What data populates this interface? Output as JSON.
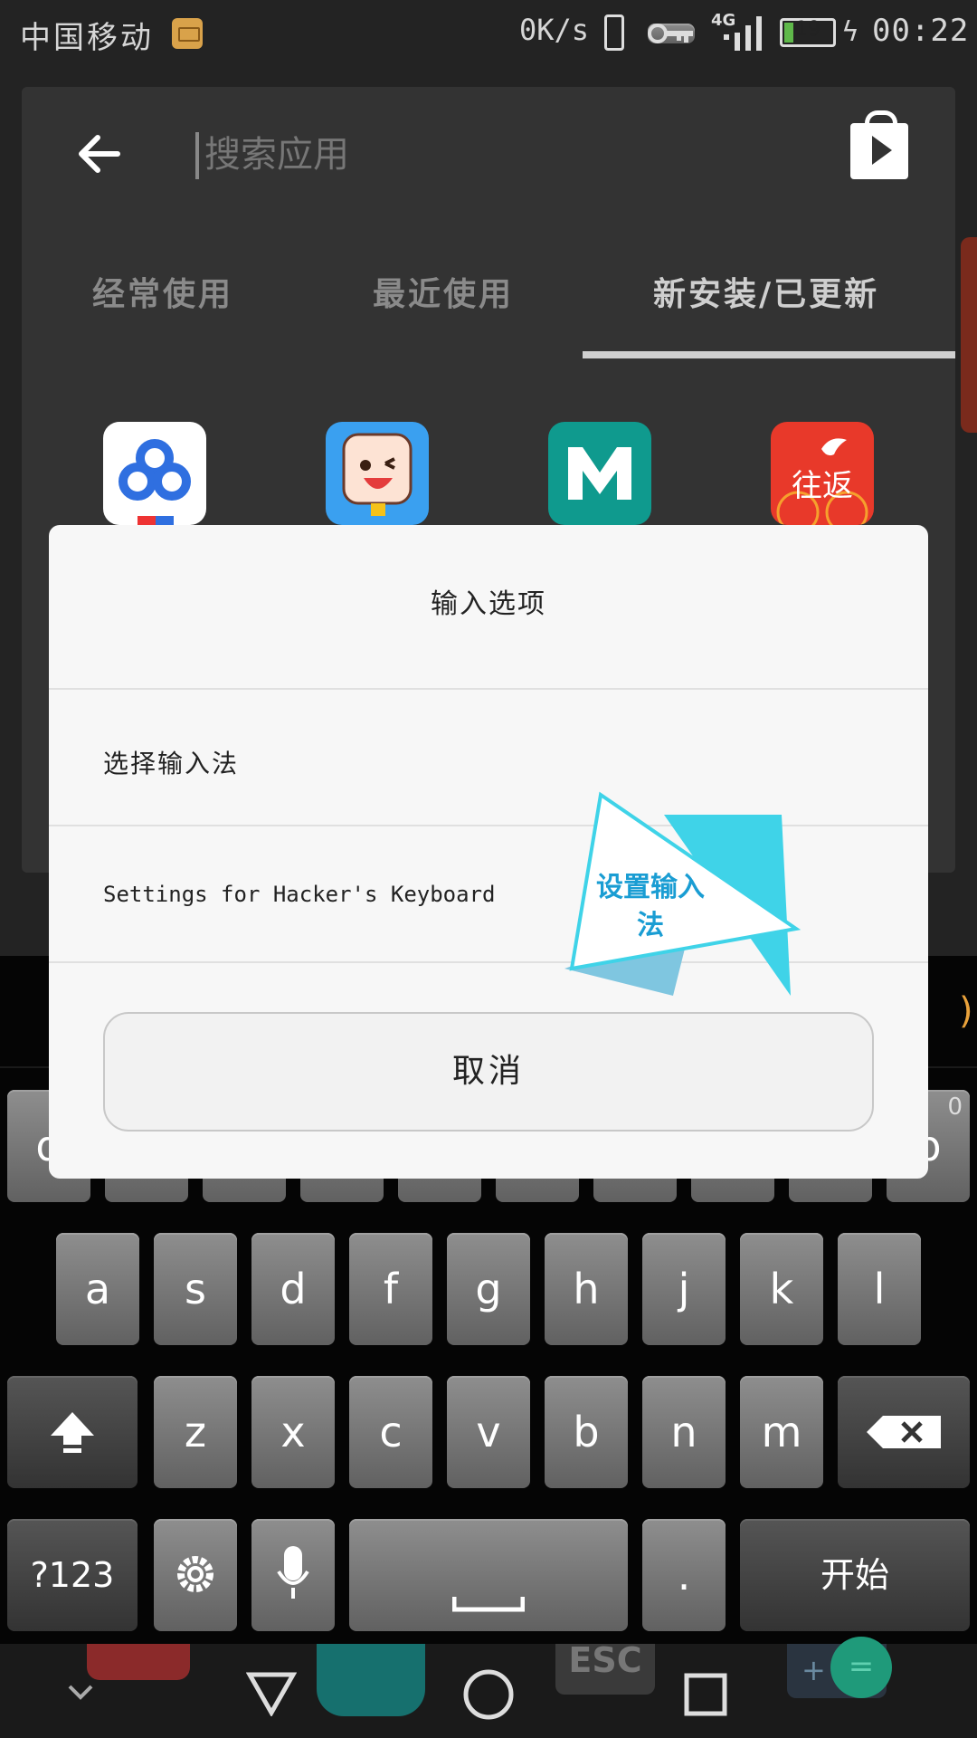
{
  "status_bar": {
    "carrier": "中国移动",
    "speed": "0K/s",
    "network": "4G",
    "battery": "19",
    "battery_level": 0.19,
    "time": "00:22"
  },
  "drawer": {
    "search_placeholder": "搜索应用",
    "tabs": [
      {
        "label": "经常使用"
      },
      {
        "label": "最近使用"
      },
      {
        "label": "新安装/已更新"
      }
    ],
    "active_tab": 2,
    "apps": [
      {
        "icon": "baidu-cloud-icon",
        "color": "#ffffff"
      },
      {
        "icon": "cartoon-face-icon",
        "color": "#3aa0f0"
      },
      {
        "icon": "m-letter-icon",
        "color": "#0f9a8e",
        "glyph": "M"
      },
      {
        "icon": "festival-icon",
        "color": "#e8392a",
        "glyph": "往返"
      }
    ]
  },
  "dialog": {
    "title": "输入选项",
    "options": [
      {
        "label": "选择输入法"
      },
      {
        "label": "Settings for Hacker's Keyboard"
      }
    ],
    "cancel": "取消",
    "badge_text": "设置输入法"
  },
  "keyboard": {
    "row_top_left": "q",
    "row_top_right": "p",
    "row_top_right_sub": "0",
    "row2": [
      "a",
      "s",
      "d",
      "f",
      "g",
      "h",
      "j",
      "k",
      "l"
    ],
    "row3": [
      "z",
      "x",
      "c",
      "v",
      "b",
      "n",
      "m"
    ],
    "sym": "?123",
    "period": ".",
    "enter": "开始",
    "candidate_paren": ")"
  },
  "nav": {
    "esc_label": "ESC",
    "plus": "+",
    "equals": "="
  },
  "colors": {
    "badge_cyan": "#3fd3e8",
    "badge_text": "#1a9dd3",
    "accent_paren": "#e9a23b"
  }
}
